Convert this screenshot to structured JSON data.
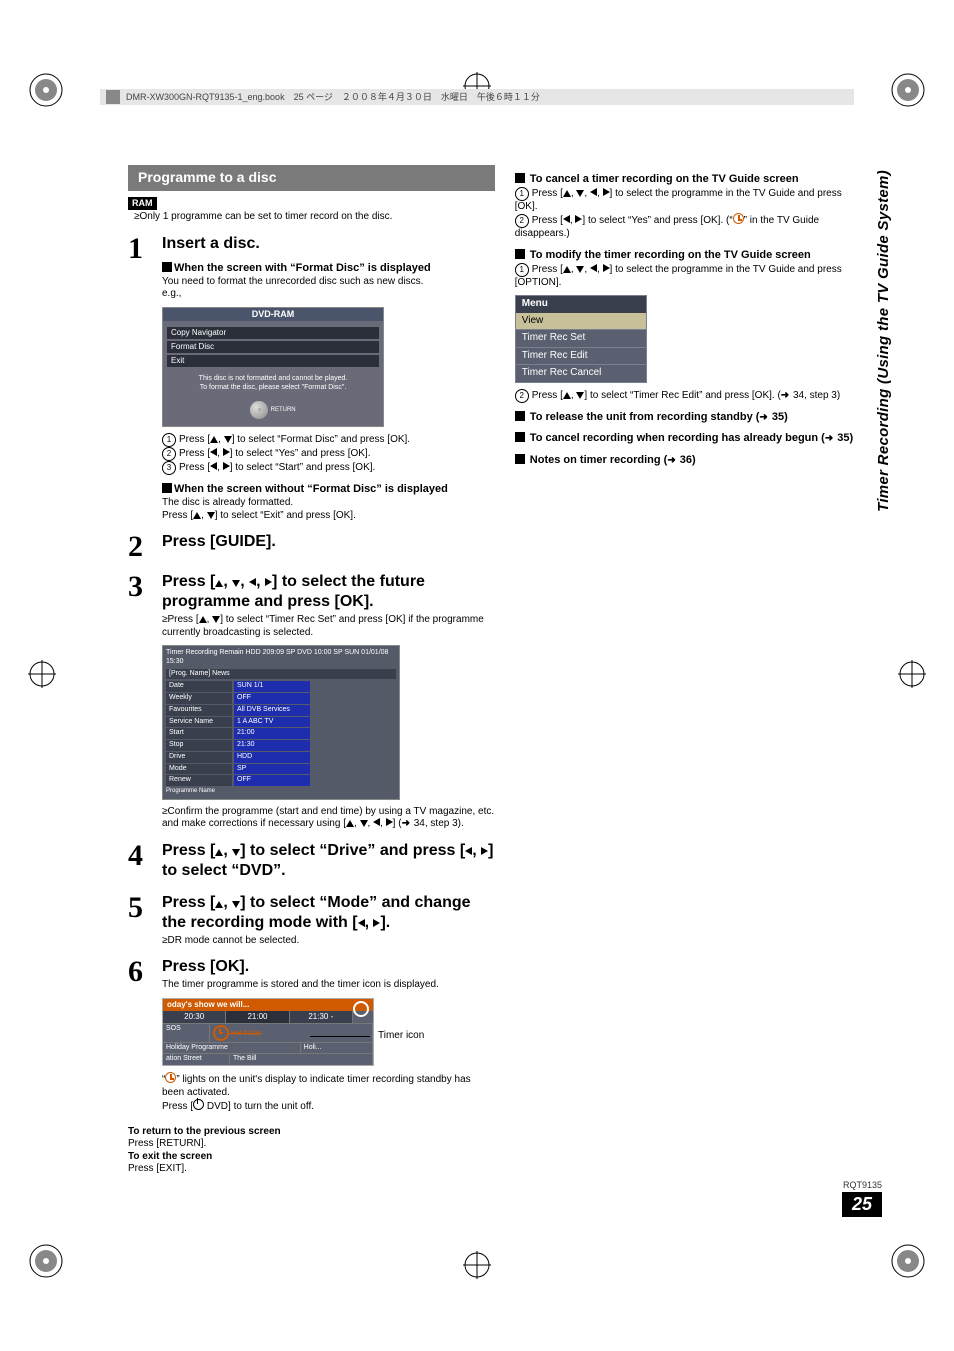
{
  "header_strip": "DMR-XW300GN-RQT9135-1_eng.book　25 ページ　２００８年４月３０日　水曜日　午後６時１１分",
  "section_title": "Programme to a disc",
  "badge_ram": "RAM",
  "note_one_prog": "Only 1 programme can be set to timer record on the disc.",
  "steps": {
    "s1": {
      "num": "1",
      "head": "Insert a disc.",
      "sub_format": "When the screen with “Format Disc” is displayed",
      "format_explain": "You need to format the unrecorded disc such as new discs.",
      "eg": "e.g.,",
      "osd": {
        "title": "DVD-RAM",
        "items": [
          "Copy Navigator",
          "Format Disc",
          "Exit"
        ],
        "msg": "This disc is not formatted and cannot be played.\nTo format the disc, please select \"Format Disc\".",
        "return": "RETURN"
      },
      "c1_prefix": "Press [",
      "c1_suffix": "] to select “Format Disc” and press [OK].",
      "c1_mid": ", ",
      "c2_prefix": "Press [",
      "c2_suffix": "] to select “Yes” and press [OK].",
      "c3_prefix": "Press [",
      "c3_suffix": "] to select “Start” and press [OK].",
      "sub_noformat": "When the screen without “Format Disc” is displayed",
      "noformat_1": "The disc is already formatted.",
      "noformat_2_prefix": "Press [",
      "noformat_2_suffix": "] to select “Exit” and press [OK]."
    },
    "s2": {
      "num": "2",
      "head": "Press [GUIDE]."
    },
    "s3": {
      "num": "3",
      "head_prefix": "Press [",
      "head_suffix": "] to select the future programme and press [OK].",
      "note_prefix": "Press [",
      "note_suffix": "] to select “Timer Rec Set” and press [OK] if the programme currently broadcasting is selected.",
      "confirm_prefix": "Confirm the programme (start and end time) by using a TV magazine, etc. and make corrections if necessary using [",
      "confirm_suffix": "] (",
      "confirm_ref": "34, step 3).",
      "timer_osd": {
        "header": "Timer Recording  Remain  HDD 209:09 SP  DVD  10:00 SP   SUN 01/01/08  15:30",
        "progname": "[Prog. Name]  News",
        "rows": [
          {
            "lab": "Date",
            "val": "SUN 1/1"
          },
          {
            "lab": "Weekly",
            "val": "OFF"
          },
          {
            "lab": "Favourites",
            "val": "All DVB Services"
          },
          {
            "lab": "Service Name",
            "val": "1   A   ABC TV"
          },
          {
            "lab": "Start",
            "val": "21:00"
          },
          {
            "lab": "Stop",
            "val": "21:30"
          },
          {
            "lab": "Drive",
            "val": "HDD"
          },
          {
            "lab": "Mode",
            "val": "SP"
          },
          {
            "lab": "Renew",
            "val": "OFF"
          }
        ],
        "pname": "Programme Name"
      }
    },
    "s4": {
      "num": "4",
      "head_prefix": "Press [",
      "head_mid": "] to select “Drive” and press [",
      "head_suffix": "] to select “DVD”."
    },
    "s5": {
      "num": "5",
      "head_prefix": "Press [",
      "head_mid": "] to select “Mode” and change the recording mode with [",
      "head_suffix": "].",
      "note": "DR mode cannot be selected."
    },
    "s6": {
      "num": "6",
      "head": "Press [OK].",
      "note": "The timer programme is stored and the timer icon is displayed.",
      "guide": {
        "title": "oday's show we will...",
        "times": [
          "20:30",
          "21:00",
          "21:30 -"
        ],
        "row1a": "SOS",
        "row1b": "Hard Cop",
        "row2a": "Holiday Programme",
        "row2b": "Holi...",
        "row3a": "ation Street",
        "row3b": "The Bill"
      },
      "timer_icon_label": "Timer icon",
      "post1_prefix": "“",
      "post1_suffix": "” lights on the unit's display to indicate timer recording standby has been activated.",
      "post2_prefix": "Press [",
      "post2_suffix": " DVD] to turn the unit off."
    }
  },
  "return_block": {
    "l1b": "To return to the previous screen",
    "l1": "Press [RETURN].",
    "l2b": "To exit the screen",
    "l2": "Press [EXIT]."
  },
  "right": {
    "h1": "To cancel a timer recording on the TV Guide screen",
    "h1_c1_prefix": "Press [",
    "h1_c1_suffix": "] to select the programme in the TV Guide and press [OK].",
    "h1_c2_prefix": "Press [",
    "h1_c2_mid": "] to select “Yes” and press [OK]. (“",
    "h1_c2_suffix": "” in the TV Guide disappears.)",
    "h2": "To modify the timer recording on the TV Guide screen",
    "h2_c1_prefix": "Press [",
    "h2_c1_suffix": "] to select the programme in the TV Guide and press [OPTION].",
    "menu": {
      "hdr": "Menu",
      "sel": "View",
      "items": [
        "Timer Rec Set",
        "Timer Rec Edit",
        "Timer Rec Cancel"
      ]
    },
    "h2_c2_prefix": "Press [",
    "h2_c2_suffix": "] to select “Timer Rec Edit” and press [OK]. (",
    "h2_c2_ref": " 34, step 3)",
    "h3_prefix": "To release the unit from recording standby (",
    "h3_ref": " 35)",
    "h4_prefix": "To cancel recording when recording has already begun (",
    "h4_ref": " 35)",
    "h5_prefix": "Notes on timer recording (",
    "h5_ref": " 36)"
  },
  "side_title": "Timer Recording (Using the TV Guide System)",
  "footer": {
    "code": "RQT9135",
    "page": "25"
  }
}
